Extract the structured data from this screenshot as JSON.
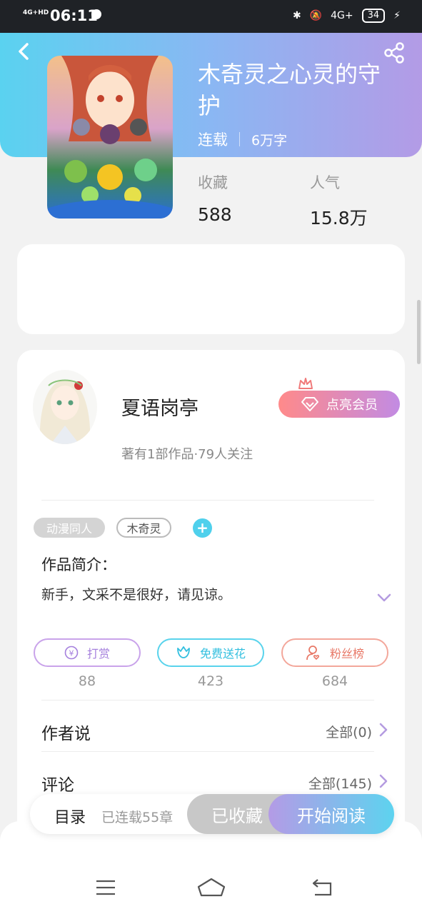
{
  "status_bar": {
    "signal": "4G+HD",
    "time": "06:11",
    "network": "4G+",
    "battery": "34"
  },
  "book": {
    "title": "木奇灵之心灵的守护",
    "status": "连载",
    "word_count": "6万字"
  },
  "stats": {
    "collect_label": "收藏",
    "collect_value": "588",
    "popularity_label": "人气",
    "popularity_value": "15.8万"
  },
  "author": {
    "name": "夏语岗亭",
    "subtitle": "著有1部作品·79人关注",
    "vip_label": "点亮会员"
  },
  "tags": [
    "动漫同人",
    "木奇灵"
  ],
  "intro": {
    "label": "作品简介：",
    "text": "新手，文采不是很好，请见谅。"
  },
  "actions": [
    {
      "label": "打赏",
      "count": "88"
    },
    {
      "label": "免费送花",
      "count": "423"
    },
    {
      "label": "粉丝榜",
      "count": "684"
    }
  ],
  "author_says": {
    "label": "作者说",
    "more": "全部(0)"
  },
  "comments": {
    "label": "评论",
    "more": "全部(145)"
  },
  "bottom": {
    "toc": "目录",
    "toc_status": "已连载55章",
    "collected": "已收藏",
    "read": "开始阅读"
  },
  "colors": {
    "accent_cyan": "#5ad2f0",
    "accent_purple": "#b39be6",
    "vip_pink": "#ff8a8a"
  }
}
